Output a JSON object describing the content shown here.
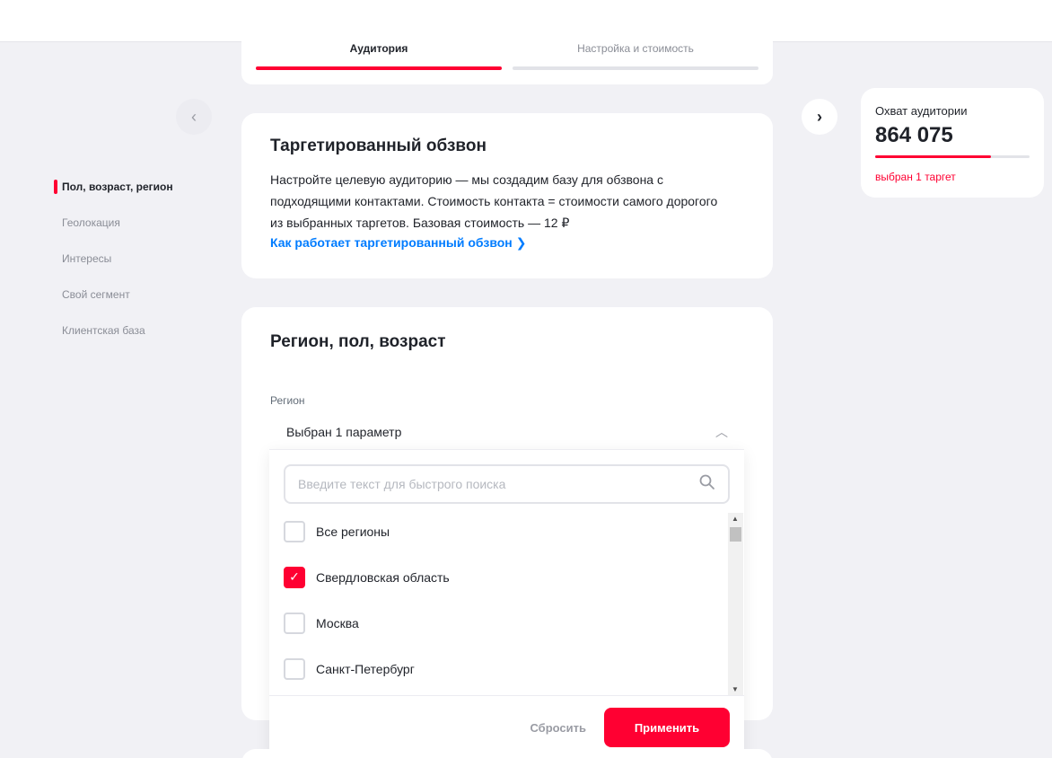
{
  "steps": [
    {
      "label": "Аудитория",
      "active": true
    },
    {
      "label": "Настройка и стоимость",
      "active": false
    }
  ],
  "nav": {
    "prev_icon": "chevron-left-icon",
    "next_icon": "chevron-right-icon"
  },
  "sidebar": {
    "items": [
      {
        "label": "Пол, возраст, регион",
        "active": true
      },
      {
        "label": "Геолокация",
        "active": false
      },
      {
        "label": "Интересы",
        "active": false
      },
      {
        "label": "Свой сегмент",
        "active": false
      },
      {
        "label": "Клиентская база",
        "active": false
      }
    ]
  },
  "reach": {
    "title": "Охват аудитории",
    "value": "864 075",
    "progress": 0.75,
    "subtitle": "выбран 1 таргет"
  },
  "info_card": {
    "title": "Таргетированный обзвон",
    "text": "Настройте целевую аудиторию — мы создадим базу для обзвона с подходящими контактами. Стоимость контакта = стоимости самого дорогого из выбранных таргетов. Базовая стоимость — 12 ₽",
    "link": "Как работает таргетированный обзвон"
  },
  "region_card": {
    "title": "Регион, пол, возраст",
    "field_label": "Регион",
    "selected_text": "Выбран 1 параметр",
    "search_placeholder": "Введите текст для быстрого поиска",
    "options": [
      {
        "label": "Все регионы",
        "checked": false
      },
      {
        "label": "Свердловская область",
        "checked": true
      },
      {
        "label": "Москва",
        "checked": false
      },
      {
        "label": "Санкт-Петербург",
        "checked": false
      }
    ],
    "reset_label": "Сбросить",
    "apply_label": "Применить"
  },
  "colors": {
    "accent": "#ff0032",
    "link": "#007cff",
    "background": "#f1f1f5"
  }
}
